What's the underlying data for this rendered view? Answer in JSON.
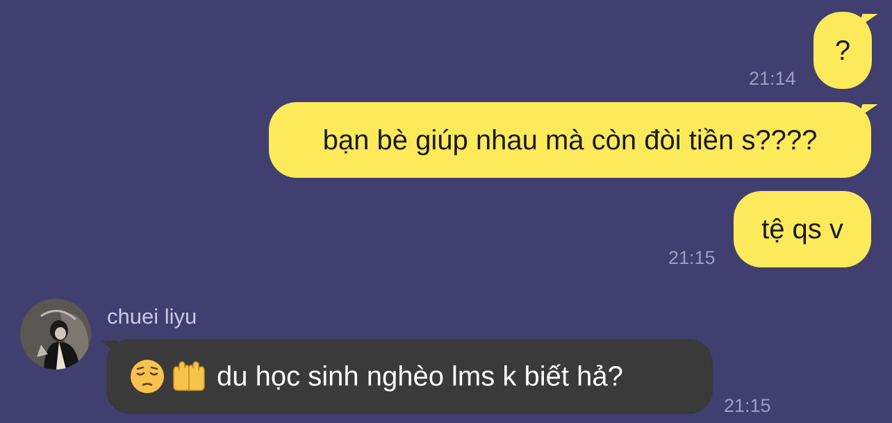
{
  "messages": [
    {
      "direction": "out",
      "text": "?",
      "time": "21:14"
    },
    {
      "direction": "out",
      "text": "bạn bè giúp nhau mà còn đòi tiền s????",
      "time": ""
    },
    {
      "direction": "out",
      "text": "tệ qs v",
      "time": "21:15"
    },
    {
      "direction": "in",
      "sender": "chuei liyu",
      "emojis": [
        "pensive-face-emoji",
        "palms-up-together-emoji"
      ],
      "text": "du học sinh nghèo lms k biết hả?",
      "time": "21:15"
    }
  ],
  "colors": {
    "background": "#413f6f",
    "outgoing_bubble": "#fdea5a",
    "incoming_bubble": "#3a3a3a",
    "timestamp": "#9e9cc4"
  }
}
